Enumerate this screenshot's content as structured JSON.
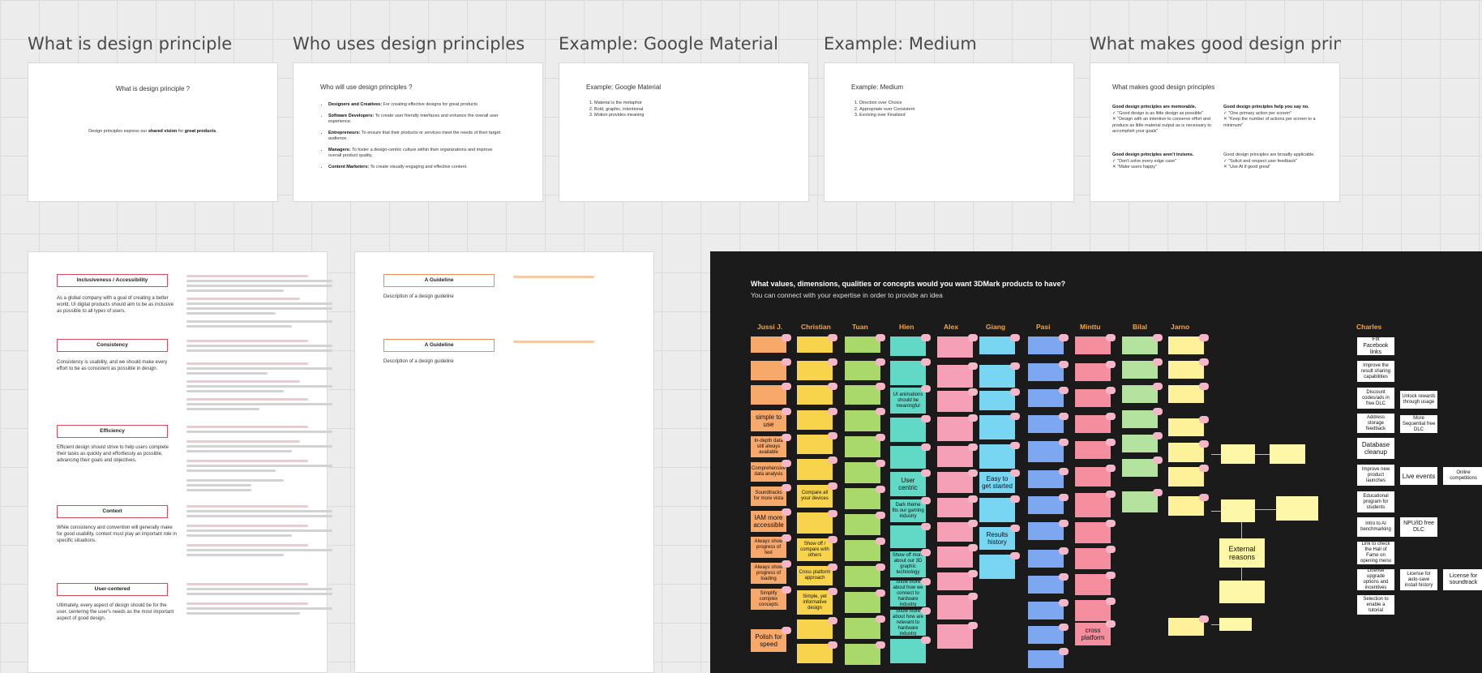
{
  "frames": [
    {
      "title": "What is design principle"
    },
    {
      "title": "Who uses design principles"
    },
    {
      "title": "Example: Google Material"
    },
    {
      "title": "Example: Medium"
    },
    {
      "title": "What makes good design princi..."
    }
  ],
  "card1": {
    "heading": "What is design principle ?",
    "body_pre": "Design principles express our ",
    "body_b1": "shared vision",
    "body_mid": " for ",
    "body_b2": "great products",
    "body_end": "."
  },
  "card2": {
    "heading": "Who will use design principles ?",
    "items": [
      {
        "b": "Designers and Creatives:",
        "t": " For creating effective designs for great products"
      },
      {
        "b": "Software Developers:",
        "t": " To create user friendly interfaces and enhance the overall user experience."
      },
      {
        "b": "Entrepreneurs:",
        "t": " To ensure that their products or services meet the needs of their target audience."
      },
      {
        "b": "Managers:",
        "t": " To foster a design-centric culture within their organizations and improve overall product quality."
      },
      {
        "b": "Content Marketers:",
        "t": " To create visually engaging and effective content."
      }
    ]
  },
  "card3": {
    "heading": "Example: Google Material",
    "items": [
      "Material is the metaphor",
      "Bold, graphic, intentional",
      "Motion provides meaning"
    ]
  },
  "card4": {
    "heading": "Example: Medium",
    "items": [
      "Direction over Choice",
      "Appropriate over Consistent",
      "Evolving over Finalized"
    ]
  },
  "card5": {
    "heading": "What makes good design principles",
    "blocks": [
      {
        "title": "Good design principles are memorable.",
        "lines": [
          "✓ \"Good design is as little design as possible\"",
          "✕ \"Design with an intention to conserve effort and produce as little material output as is necessary to accomplish your goals\""
        ]
      },
      {
        "title": "Good design principles help you say no.",
        "lines": [
          "✓ \"One primary action per screen\"",
          "✕ \"Keep the number of actions per screen to a minimum\""
        ]
      },
      {
        "title": "Good design principles aren't truisms.",
        "lines": [
          "✓ \"Don't solve every edge case\"",
          "✕ \"Make users happy\""
        ]
      },
      {
        "title": "Good design principles are broadly applicable.",
        "lines": [
          "✓ \"Solicit and respect user feedback\"",
          "✕ \"Use AI if good great\""
        ]
      }
    ]
  },
  "doc1": {
    "principles": [
      {
        "name": "Inclusiveness / Accessibility",
        "desc": "As a global company with a goal of creating a better world, UI digital products should aim to be as inclusive as possible to all types of users."
      },
      {
        "name": "Consistency",
        "desc": "Consistency is usability, and we should make every effort to be as consistent as possible in design."
      },
      {
        "name": "Efficiency",
        "desc": "Efficient design should strive to help users complete their tasks as quickly and effortlessly as possible, advancing their goals and objectives."
      },
      {
        "name": "Context",
        "desc": "While consistency and convention will generally make for good usability, context must play an important role in specific situations."
      },
      {
        "name": "User-centered",
        "desc": "Ultimately, every aspect of design should be for the user, centering the user's needs as the most important aspect of good design."
      }
    ]
  },
  "doc2": {
    "guides": [
      {
        "name": "A Guideline",
        "desc": "Description of a design guideline"
      },
      {
        "name": "A Guideline",
        "desc": "Description of a design guideline"
      }
    ]
  },
  "board": {
    "question": "What values, dimensions, qualities or concepts would you want 3DMark products to have?",
    "subtitle": "You can connect with your expertise in order to provide an idea",
    "columns": [
      "Jussi J.",
      "Christian",
      "Tuan",
      "Hien",
      "Alex",
      "Giang",
      "Pasi",
      "Minttu",
      "Bilal",
      "Jarno",
      "Charles"
    ],
    "big_notes": {
      "jussi": [
        "simple to use",
        "In-depth data still always available",
        "Comprehensive data analysis",
        "Soundtracks for more vista",
        "IAM more accessible",
        "Always show progress of test",
        "Always show progress of loading",
        "Simplify complex concepts",
        "Polish for speed"
      ],
      "christian": [
        "Compare all your devices",
        "Show off / compare with others",
        "Cross platform approach",
        "Simple, yet informative design"
      ],
      "hien": [
        "UI animations should be meaningful",
        "User centric",
        "Dark theme fits our gaming industry",
        "Show off more about our 3D graphic technology",
        "Show more about how we connect to hardware industry",
        "Show more about how are relevant to hardware industry"
      ],
      "giang": [
        "Easy to get started",
        "Results history"
      ],
      "minttu": [
        "cross platform"
      ],
      "jarno": [
        "External reasons"
      ]
    },
    "charles": [
      "Fix Facebook links",
      "Improve the result sharing capabilities",
      "Discount codes/ads in free DLC",
      "Unlock rewards through usage",
      "Address storage feedback",
      "More Sequential free DLC",
      "Database cleanup",
      "Improve new product launches",
      "Live events",
      "Online competitions",
      "Educational program for students",
      "Intro to AI benchmarking",
      "NPU/ID free DLC",
      "Link to check the Hall of Fame on opening menu",
      "License upgrade options and incentives",
      "License for auto-save install history",
      "License for soundtrack",
      "Selection to enable a tutorial"
    ]
  }
}
